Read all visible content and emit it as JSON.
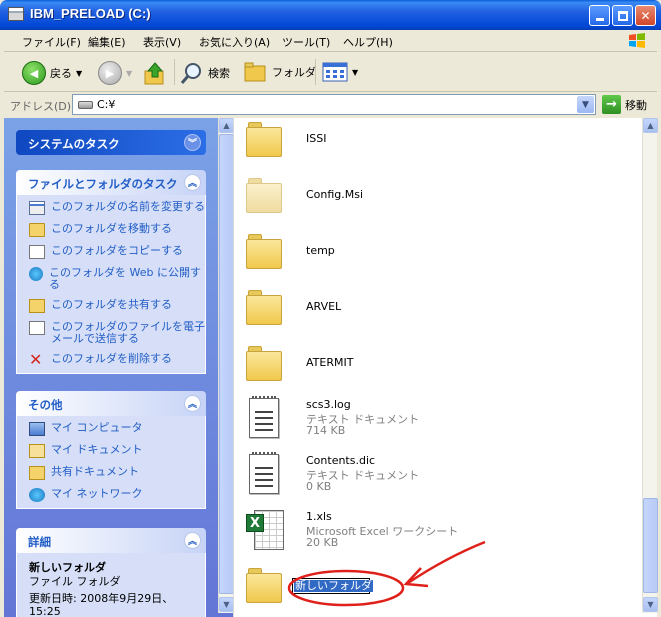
{
  "window": {
    "title": "IBM_PRELOAD (C:)"
  },
  "menu": {
    "items": [
      "ファイル(F)",
      "編集(E)",
      "表示(V)",
      "お気に入り(A)",
      "ツール(T)",
      "ヘルプ(H)"
    ]
  },
  "toolbar": {
    "back_label": "戻る",
    "search_label": "検索",
    "folders_label": "フォルダ"
  },
  "address": {
    "label": "アドレス(D)",
    "value": "C:¥",
    "go_label": "移動"
  },
  "left_pane": {
    "system_tasks": {
      "title": "システムのタスク"
    },
    "file_tasks": {
      "title": "ファイルとフォルダのタスク",
      "items": [
        "このフォルダの名前を変更する",
        "このフォルダを移動する",
        "このフォルダをコピーする",
        "このフォルダを Web に公開する",
        "このフォルダを共有する",
        "このフォルダのファイルを電子メールで送信する",
        "このフォルダを削除する"
      ]
    },
    "other": {
      "title": "その他",
      "items": [
        "マイ コンピュータ",
        "マイ ドキュメント",
        "共有ドキュメント",
        "マイ ネットワーク"
      ]
    },
    "details": {
      "title": "詳細",
      "name": "新しいフォルダ",
      "type": "ファイル フォルダ",
      "modified": "更新日時: 2008年9月29日、15:25"
    }
  },
  "files": [
    {
      "name": "ISSI",
      "kind": "folder"
    },
    {
      "name": "Config.Msi",
      "kind": "folder-hidden"
    },
    {
      "name": "temp",
      "kind": "folder"
    },
    {
      "name": "ARVEL",
      "kind": "folder"
    },
    {
      "name": "ATERMIT",
      "kind": "folder"
    },
    {
      "name": "scs3.log",
      "type": "テキスト ドキュメント",
      "size": "714 KB",
      "kind": "text"
    },
    {
      "name": "Contents.dic",
      "type": "テキスト ドキュメント",
      "size": "0 KB",
      "kind": "text"
    },
    {
      "name": "1.xls",
      "type": "Microsoft Excel ワークシート",
      "size": "20 KB",
      "kind": "excel"
    }
  ],
  "rename": {
    "value": "新しいフォルダ"
  },
  "colors": {
    "annotation": "#e0211b",
    "selection": "#316ac5",
    "link": "#215dc6"
  }
}
